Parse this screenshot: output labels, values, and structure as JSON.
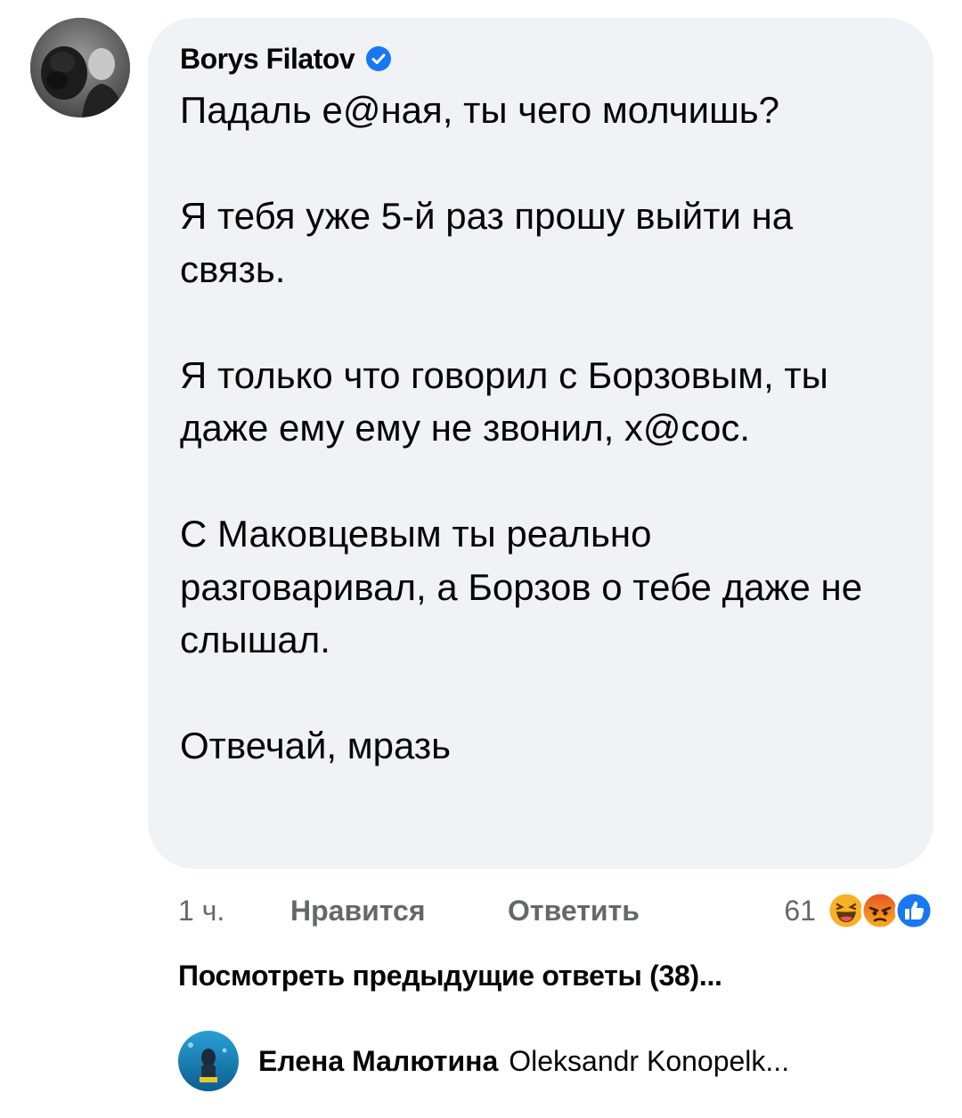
{
  "comment": {
    "author": "Borys Filatov",
    "verified_icon": "verified-badge-icon",
    "paragraphs": [
      "Падаль е@ная, ты чего молчишь?",
      "Я тебя уже 5-й раз прошу выйти на связь.",
      "Я только что говорил с Борзовым, ты даже ему ему не звонил, х@сос.",
      "С Маковцевым ты реально разговаривал, а Борзов о тебе даже не слышал.",
      "Отвечай, мразь"
    ]
  },
  "actions": {
    "time": "1 ч.",
    "like_label": "Нравится",
    "reply_label": "Ответить",
    "reaction_count": "61",
    "reaction_icons": [
      "haha-reaction-icon",
      "angry-reaction-icon",
      "like-reaction-icon"
    ]
  },
  "view_previous": "Посмотреть предыдущие ответы (38)...",
  "reply_preview": {
    "author": "Елена Малютина",
    "text": "Oleksandr Konopelk..."
  },
  "colors": {
    "bubble_bg": "#f0f2f5",
    "secondary_text": "#65676b",
    "verified_blue": "#1877f2",
    "angry_red": "#e9531e",
    "haha_yellow": "#f7b125"
  }
}
